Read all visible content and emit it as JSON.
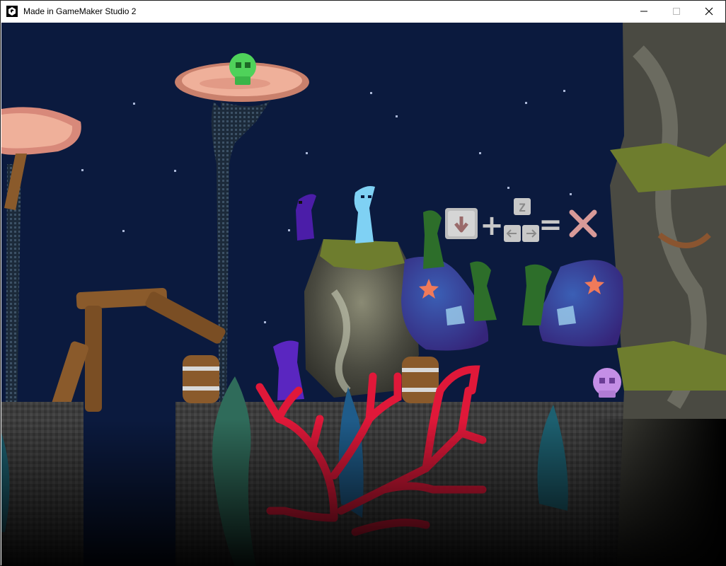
{
  "window": {
    "title": "Made in GameMaker Studio 2",
    "app_icon": "gamemaker-icon",
    "controls": [
      "minimize-icon",
      "maximize-icon",
      "close-icon"
    ]
  },
  "tutorial_hint": {
    "icons": [
      "down-arrow-key-icon",
      "plus-icon",
      "z-key-icon",
      "left-right-keys-icon",
      "equals-icon",
      "cross-icon"
    ],
    "z_key": "Z",
    "symbols": {
      "plus": "+",
      "equals": "="
    }
  },
  "colors": {
    "sky": "#0b1a3e",
    "ground": "#3b3b3b",
    "coral": "#e01839",
    "player": "#7fd1f4",
    "mushroom_cap": "#efb09a",
    "wood": "#8a5a2b"
  }
}
